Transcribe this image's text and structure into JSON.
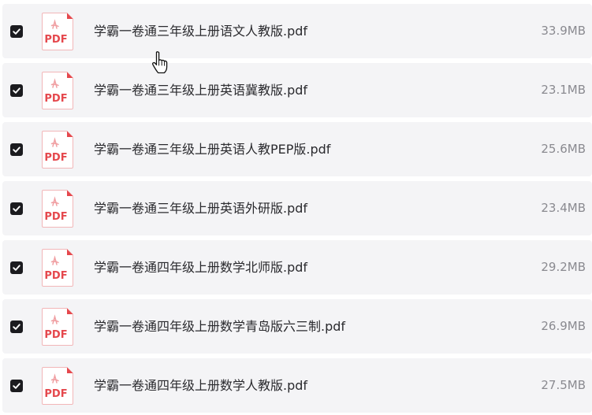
{
  "file_type_badge": "PDF",
  "colors": {
    "row_background": "#f4f4f6",
    "checkbox": "#1b1b1f",
    "pdf_red": "#e5484d",
    "text": "#2a2a2e",
    "size_text": "#8a8a90"
  },
  "files": [
    {
      "name": "学霸一卷通三年级上册语文人教版.pdf",
      "size": "33.9MB",
      "checked": true
    },
    {
      "name": "学霸一卷通三年级上册英语冀教版.pdf",
      "size": "23.1MB",
      "checked": true
    },
    {
      "name": "学霸一卷通三年级上册英语人教PEP版.pdf",
      "size": "25.6MB",
      "checked": true
    },
    {
      "name": "学霸一卷通三年级上册英语外研版.pdf",
      "size": "23.4MB",
      "checked": true
    },
    {
      "name": "学霸一卷通四年级上册数学北师版.pdf",
      "size": "29.2MB",
      "checked": true
    },
    {
      "name": "学霸一卷通四年级上册数学青岛版六三制.pdf",
      "size": "26.9MB",
      "checked": true
    },
    {
      "name": "学霸一卷通四年级上册数学人教版.pdf",
      "size": "27.5MB",
      "checked": true
    }
  ]
}
